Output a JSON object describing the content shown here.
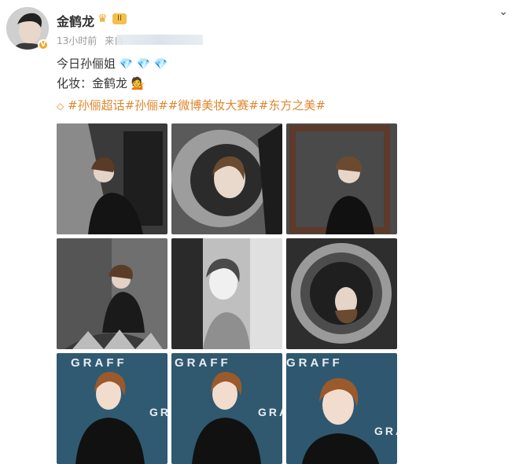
{
  "post": {
    "username": "金鹤龙",
    "vip_badge": "II",
    "time": "13小时前",
    "source_prefix": "来自",
    "line1_text": "今日孙俪姐",
    "line1_gems": "💎 💎 💎",
    "line2_text": "化妆：金鹤龙",
    "line2_emoji": "💁",
    "tags": "#孙俪超话#孙俪##微博美妆大赛##东方之美#"
  },
  "photos": {
    "text": "GRAFF"
  },
  "colors": {
    "tag_orange": "#e0872e",
    "gem_blue": "#2fb6e8",
    "verify_gold": "#f5a623",
    "graff_teal": "#2f5a72"
  },
  "icons": [
    "avatar",
    "verified-badge-icon",
    "crown-icon",
    "chevron-down-icon",
    "diamond-icon",
    "tag-icon"
  ]
}
